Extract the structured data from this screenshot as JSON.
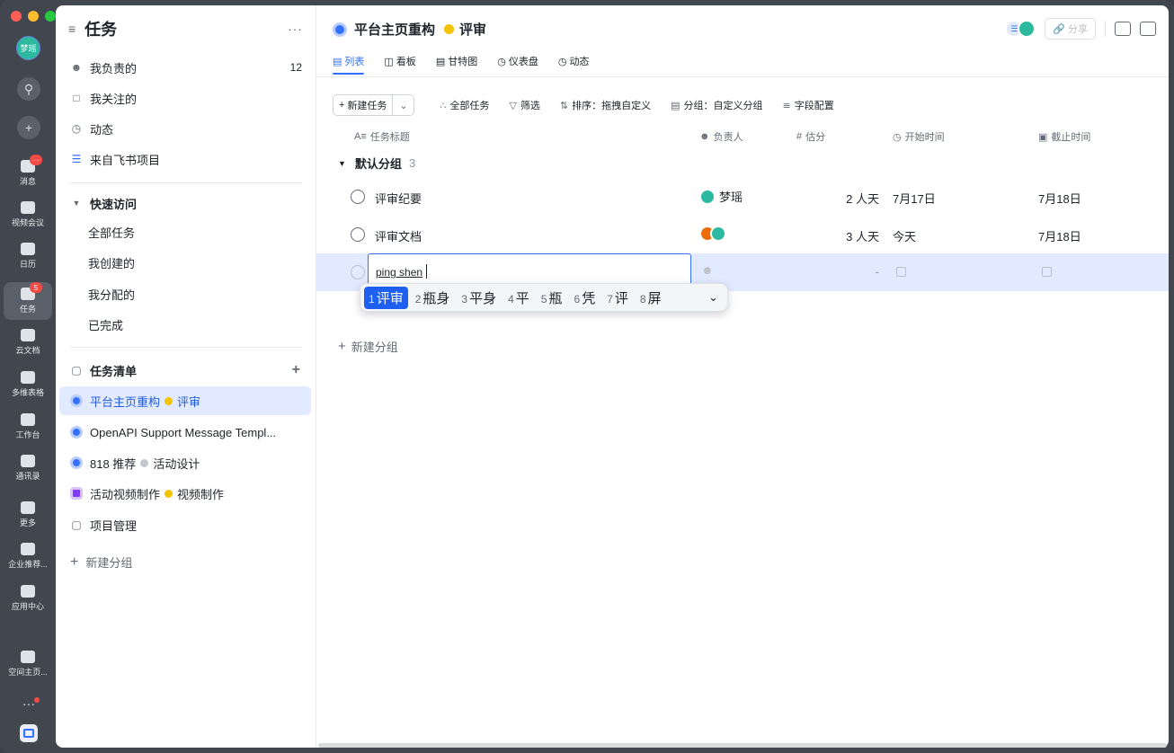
{
  "rail": {
    "avatar_text": "梦瑶",
    "items": [
      {
        "label": "消息",
        "badge": "···"
      },
      {
        "label": "视频会议",
        "badge": ""
      },
      {
        "label": "日历",
        "badge": ""
      },
      {
        "label": "任务",
        "badge": "5"
      },
      {
        "label": "云文档",
        "badge": ""
      },
      {
        "label": "多维表格",
        "badge": ""
      },
      {
        "label": "工作台",
        "badge": ""
      },
      {
        "label": "通讯录",
        "badge": ""
      },
      {
        "label": "更多",
        "badge": ""
      },
      {
        "label": "企业推荐...",
        "badge": ""
      },
      {
        "label": "应用中心",
        "badge": ""
      },
      {
        "label": "空间主页...",
        "badge": ""
      }
    ],
    "more_label": "···"
  },
  "sidebar": {
    "title": "任务",
    "more": "···",
    "top_items": [
      {
        "label": "我负责的",
        "count": "12",
        "icon": "person-icon"
      },
      {
        "label": "我关注的",
        "count": "",
        "icon": "bookmark-icon"
      },
      {
        "label": "动态",
        "count": "",
        "icon": "clock-icon"
      },
      {
        "label": "来自飞书项目",
        "count": "",
        "icon": "list-icon"
      }
    ],
    "quick_access": {
      "title": "快速访问",
      "items": [
        "全部任务",
        "我创建的",
        "我分配的",
        "已完成"
      ]
    },
    "task_lists": {
      "title": "任务清单",
      "items": [
        {
          "name": "平台主页重构",
          "status": "评审",
          "status_color": "#f5c400",
          "selected": true
        },
        {
          "name": "OpenAPI Support Message Templ...",
          "status": "",
          "status_color": "",
          "selected": false
        },
        {
          "name": "818 推荐",
          "status": "活动设计",
          "status_color": "#c4c7cc",
          "selected": false
        },
        {
          "name": "活动视频制作",
          "status": "视频制作",
          "status_color": "#f5c400",
          "selected": false
        },
        {
          "name": "项目管理",
          "status": "",
          "status_color": "",
          "selected": false
        }
      ]
    },
    "new_group": "新建分组"
  },
  "main": {
    "project_name": "平台主页重构",
    "project_status": "评审",
    "share_label": "分享",
    "tabs": [
      "列表",
      "看板",
      "甘特图",
      "仪表盘",
      "动态"
    ],
    "toolbar": {
      "new_task": "新建任务",
      "all_tasks": "全部任务",
      "filter": "筛选",
      "sort": "排序：拖拽自定义",
      "group": "分组：自定义分组",
      "fields": "字段配置"
    },
    "columns": {
      "title": "任务标题",
      "owner": "负责人",
      "estimate": "估分",
      "start": "开始时间",
      "due": "截止时间"
    },
    "group": {
      "name": "默认分组",
      "count": "3"
    },
    "tasks": [
      {
        "title": "评审纪要",
        "owner": "梦瑶",
        "estimate": "2 人天",
        "start": "7月17日",
        "due": "7月18日"
      },
      {
        "title": "评审文档",
        "owner": "",
        "estimate": "3 人天",
        "start": "今天",
        "due": "7月18日"
      }
    ],
    "editing_row": {
      "input_text": "ping shen",
      "estimate": "-"
    },
    "ime_candidates": [
      {
        "n": "1",
        "text": "评审"
      },
      {
        "n": "2",
        "text": "瓶身"
      },
      {
        "n": "3",
        "text": "平身"
      },
      {
        "n": "4",
        "text": "平"
      },
      {
        "n": "5",
        "text": "瓶"
      },
      {
        "n": "6",
        "text": "凭"
      },
      {
        "n": "7",
        "text": "评"
      },
      {
        "n": "8",
        "text": "屏"
      }
    ],
    "new_group": "新建分组"
  },
  "colors": {
    "accent": "#3370ff",
    "selected_bg": "#e1eaff",
    "rail_bg": "#42474f"
  }
}
